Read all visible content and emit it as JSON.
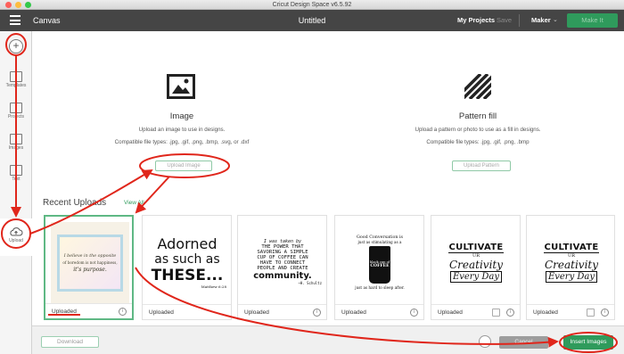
{
  "window": {
    "title": "Cricut Design Space  v6.5.92"
  },
  "header": {
    "app_label": "Canvas",
    "document_title": "Untitled",
    "my_projects": "My Projects",
    "save": "Save",
    "machine": "Maker",
    "make_it": "Make It"
  },
  "sidebar": {
    "new": "+",
    "items": [
      {
        "label": "Templates"
      },
      {
        "label": "Projects"
      },
      {
        "label": "Images"
      },
      {
        "label": "Text"
      },
      {
        "label": "Upload"
      }
    ]
  },
  "upload_options": {
    "image": {
      "title": "Image",
      "description": "Upload an image to use in designs.",
      "file_types": "Compatible file types: .jpg, .gif, .png, .bmp, .svg, or .dxf",
      "button": "Upload Image"
    },
    "pattern": {
      "title": "Pattern fill",
      "description": "Upload a pattern or photo to use as a fill in designs.",
      "file_types": "Compatible file types: .jpg, .gif, .png, .bmp",
      "button": "Upload Pattern"
    }
  },
  "recent": {
    "title": "Recent Uploads",
    "view_all": "View All",
    "cards": [
      {
        "label": "Uploaded",
        "line1": "I believe in the opposite",
        "line2": "of boredom is not happiness,",
        "line3": "it's purpose."
      },
      {
        "label": "Uploaded",
        "line1": "Adorned",
        "line2": "as such as",
        "line3": "THESE...",
        "line4": "Matthew 6:28"
      },
      {
        "label": "Uploaded",
        "line1": "I was taken by",
        "line2": "THE POWER THAT",
        "line3": "SAVORING A SIMPLE",
        "line4": "CUP OF COFFEE CAN",
        "line5": "HAVE TO CONNECT",
        "line6": "PEOPLE AND CREATE",
        "line7": "community.",
        "line8": "~H. Schultz"
      },
      {
        "label": "Uploaded",
        "line1": "Good Conversation is",
        "line2": "just as stimulating as a",
        "line3": "black cup of",
        "line4": "COFFEE",
        "line5": "just as hard to sleep after."
      },
      {
        "label": "Uploaded",
        "line1": "CULTIVATE",
        "line2": "UR",
        "line3": "Creativity",
        "line4": "Every Day"
      },
      {
        "label": "Uploaded",
        "line1": "CULTIVATE",
        "line2": "UR",
        "line3": "Creativity",
        "line4": "Every Day"
      }
    ]
  },
  "bottom": {
    "download": "Download",
    "cancel": "Cancel",
    "insert": "Insert Images"
  },
  "colors": {
    "accent_green": "#2f9b5c",
    "annotation_red": "#e0261b",
    "header_dark": "#454545"
  },
  "icons": {
    "menu": "hamburger-icon",
    "image_option": "image-icon",
    "pattern_option": "pattern-stripes-icon",
    "upload": "cloud-upload-icon",
    "info": "info-icon",
    "trash": "trash-icon"
  }
}
